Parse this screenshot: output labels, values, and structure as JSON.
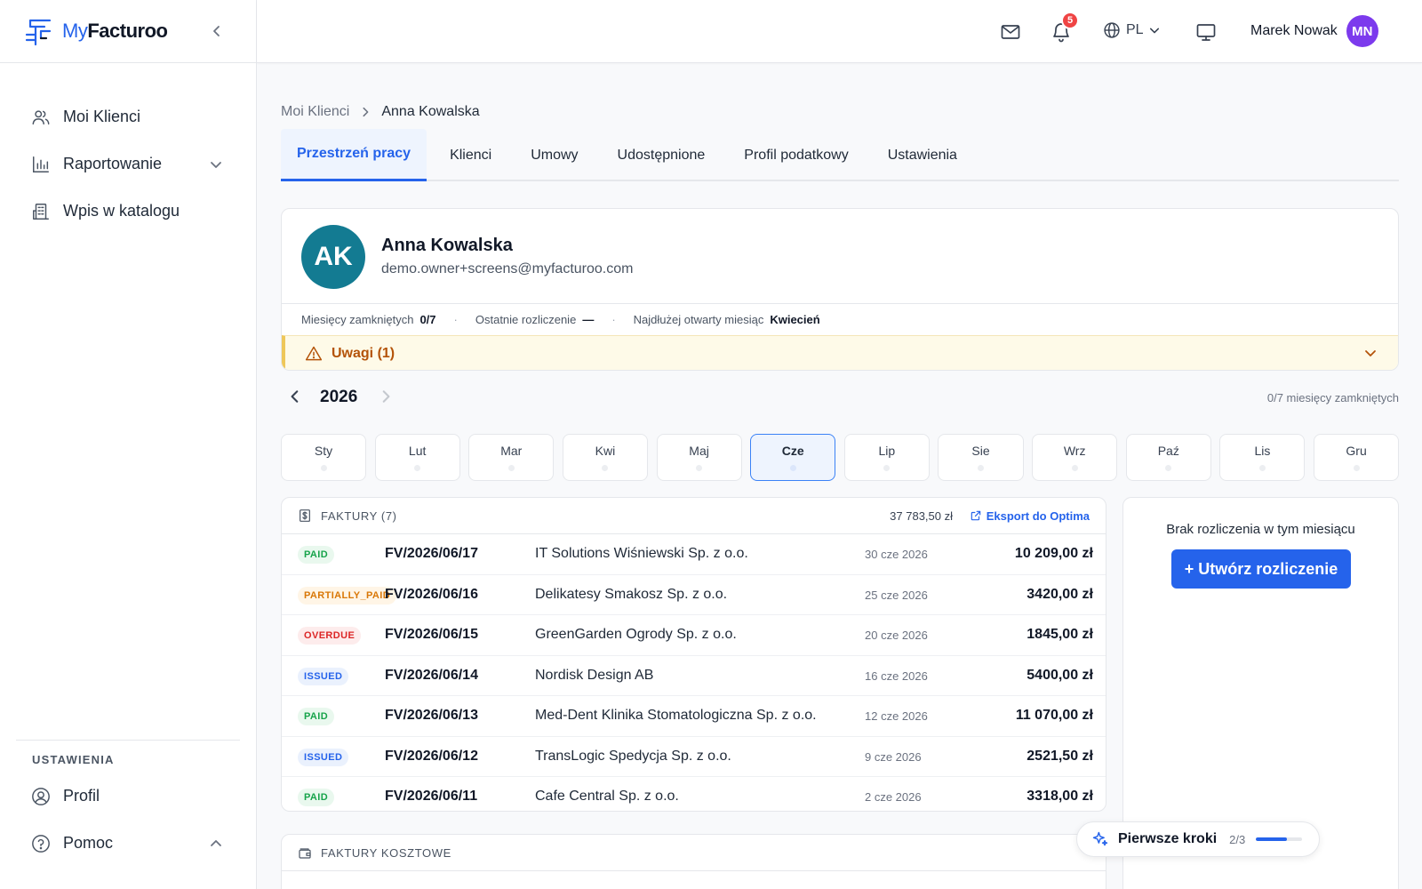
{
  "brand": {
    "my": "My",
    "name": "Facturoo"
  },
  "sidebar": {
    "items": [
      {
        "label": "Moi Klienci"
      },
      {
        "label": "Raportowanie"
      },
      {
        "label": "Wpis w katalogu"
      }
    ],
    "settings_header": "USTAWIENIA",
    "bottom_items": [
      {
        "label": "Profil"
      },
      {
        "label": "Pomoc"
      }
    ]
  },
  "topbar": {
    "notifications_count": "5",
    "language": "PL",
    "user_name": "Marek Nowak",
    "user_initials": "MN"
  },
  "breadcrumb": {
    "parent": "Moi Klienci",
    "current": "Anna Kowalska"
  },
  "tabs": [
    {
      "label": "Przestrzeń pracy"
    },
    {
      "label": "Klienci"
    },
    {
      "label": "Umowy"
    },
    {
      "label": "Udostępnione"
    },
    {
      "label": "Profil podatkowy"
    },
    {
      "label": "Ustawienia"
    }
  ],
  "client": {
    "initials": "AK",
    "name": "Anna Kowalska",
    "email": "demo.owner+screens@myfacturoo.com",
    "stats": {
      "closed_label": "Miesięcy zamkniętych",
      "closed_value": "0/7",
      "last_label": "Ostatnie rozliczenie",
      "last_value": "—",
      "longest_label": "Najdłużej otwarty miesiąc",
      "longest_value": "Kwiecień"
    },
    "notes_label": "Uwagi (1)"
  },
  "calendar": {
    "year": "2026",
    "closed_summary": "0/7 miesięcy zamkniętych",
    "months": [
      "Sty",
      "Lut",
      "Mar",
      "Kwi",
      "Maj",
      "Cze",
      "Lip",
      "Sie",
      "Wrz",
      "Paź",
      "Lis",
      "Gru"
    ],
    "selected": "Cze"
  },
  "invoices": {
    "title": "FAKTURY (7)",
    "total": "37 783,50 zł",
    "export_label": "Eksport do Optima",
    "rows": [
      {
        "status": "PAID",
        "number": "FV/2026/06/17",
        "client": "IT Solutions Wiśniewski Sp. z o.o.",
        "date": "30 cze 2026",
        "amount": "10 209,00 zł"
      },
      {
        "status": "PARTIALLY_PAID",
        "number": "FV/2026/06/16",
        "client": "Delikatesy Smakosz Sp. z o.o.",
        "date": "25 cze 2026",
        "amount": "3420,00 zł"
      },
      {
        "status": "OVERDUE",
        "number": "FV/2026/06/15",
        "client": "GreenGarden Ogrody Sp. z o.o.",
        "date": "20 cze 2026",
        "amount": "1845,00 zł"
      },
      {
        "status": "ISSUED",
        "number": "FV/2026/06/14",
        "client": "Nordisk Design AB",
        "date": "16 cze 2026",
        "amount": "5400,00 zł"
      },
      {
        "status": "PAID",
        "number": "FV/2026/06/13",
        "client": "Med-Dent Klinika Stomatologiczna Sp. z o.o.",
        "date": "12 cze 2026",
        "amount": "11 070,00 zł"
      },
      {
        "status": "ISSUED",
        "number": "FV/2026/06/12",
        "client": "TransLogic Spedycja Sp. z o.o.",
        "date": "9 cze 2026",
        "amount": "2521,50 zł"
      },
      {
        "status": "PAID",
        "number": "FV/2026/06/11",
        "client": "Cafe Central Sp. z o.o.",
        "date": "2 cze 2026",
        "amount": "3318,00 zł"
      }
    ]
  },
  "settlement": {
    "empty_message": "Brak rozliczenia w tym miesiącu",
    "create_label": "+ Utwórz rozliczenie"
  },
  "cost_invoices": {
    "title": "FAKTURY KOSZTOWE"
  },
  "onboarding": {
    "label": "Pierwsze kroki",
    "progress_text": "2/3",
    "progress": 0.67
  },
  "colors": {
    "accent": "#2563eb",
    "avatar_client": "#137b92",
    "avatar_user": "#7c3aed",
    "warning_bg": "#fefae8"
  }
}
